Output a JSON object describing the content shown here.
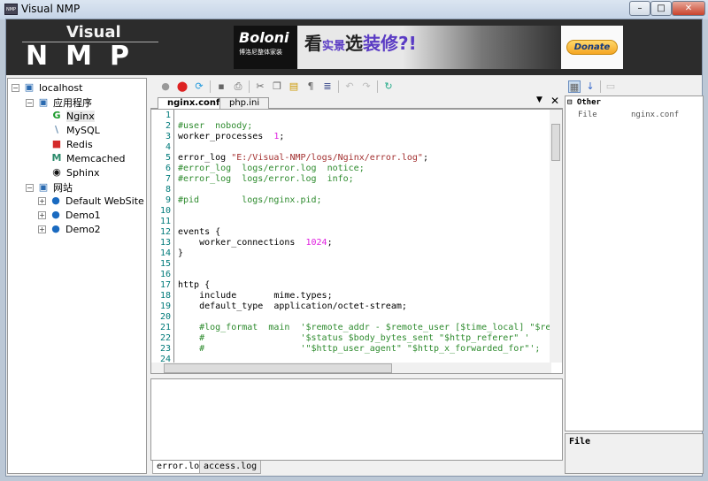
{
  "window": {
    "title": "Visual NMP",
    "controls": [
      "–",
      "□",
      "✕"
    ]
  },
  "header": {
    "logo_top": "Visual",
    "logo_bottom": "NMP",
    "ad": {
      "brand": "Boloni",
      "brand_sub": "博洛尼整体家装",
      "slogan_a": "看",
      "slogan_b": "实景",
      "slogan_c": "选",
      "slogan_d": "装修?!",
      "donate": "Donate"
    }
  },
  "tree": {
    "root": "localhost",
    "apps_group": "应用程序",
    "apps": [
      {
        "label": "Nginx",
        "icon": "nginx-icon",
        "glyph": "G",
        "color": "#1a9a2a"
      },
      {
        "label": "MySQL",
        "icon": "mysql-icon",
        "glyph": "\\",
        "color": "#6a8fb0"
      },
      {
        "label": "Redis",
        "icon": "redis-icon",
        "glyph": "■",
        "color": "#d42a2a"
      },
      {
        "label": "Memcached",
        "icon": "memcached-icon",
        "glyph": "M",
        "color": "#2a8a6a"
      },
      {
        "label": "Sphinx",
        "icon": "sphinx-icon",
        "glyph": "◉",
        "color": "#111"
      }
    ],
    "sites_group": "网站",
    "sites": [
      "Default WebSite",
      "Demo1",
      "Demo2"
    ],
    "selected": "Nginx"
  },
  "editor": {
    "tabs": [
      "nginx.conf",
      "php.ini"
    ],
    "active_tab": "nginx.conf",
    "lines": [
      {
        "t": "",
        "c": "n"
      },
      {
        "t": "#user  nobody;",
        "c": "g"
      },
      {
        "t": "worker_processes  |1|;",
        "c": "n"
      },
      {
        "t": "",
        "c": "n"
      },
      {
        "t": "error_log ~\"E:/Visual-NMP/logs/Nginx/error.log\"~;",
        "c": "n"
      },
      {
        "t": "#error_log  logs/error.log  notice;",
        "c": "g"
      },
      {
        "t": "#error_log  logs/error.log  info;",
        "c": "g"
      },
      {
        "t": "",
        "c": "n"
      },
      {
        "t": "#pid        logs/nginx.pid;",
        "c": "g"
      },
      {
        "t": "",
        "c": "n"
      },
      {
        "t": "",
        "c": "n"
      },
      {
        "t": "events {",
        "c": "n"
      },
      {
        "t": "    worker_connections  |1024|;",
        "c": "n"
      },
      {
        "t": "}",
        "c": "n"
      },
      {
        "t": "",
        "c": "n"
      },
      {
        "t": "",
        "c": "n"
      },
      {
        "t": "http {",
        "c": "n"
      },
      {
        "t": "    include       mime.types;",
        "c": "n"
      },
      {
        "t": "    default_type  application/octet-stream;",
        "c": "n"
      },
      {
        "t": "",
        "c": "n"
      },
      {
        "t": "    #log_format  main  '$remote_addr - $remote_user [$time_local] \"$request\"",
        "c": "g"
      },
      {
        "t": "    #                  '$status $body_bytes_sent \"$http_referer\" '",
        "c": "g"
      },
      {
        "t": "    #                  '\"$http_user_agent\" \"$http_x_forwarded_for\"';",
        "c": "g"
      },
      {
        "t": "",
        "c": "n"
      }
    ]
  },
  "output": {
    "tabs": [
      "error.log",
      "access.log"
    ],
    "active_tab": "error.log"
  },
  "properties": {
    "category": "Other",
    "rows": [
      {
        "name": "File",
        "value": "nginx.conf"
      }
    ],
    "description_title": "File"
  },
  "colors": {
    "comment": "#2e8b2e",
    "string": "#a33030",
    "number": "#e020e0",
    "line_number": "#007a7a",
    "header_bg": "#2c2c2c"
  }
}
